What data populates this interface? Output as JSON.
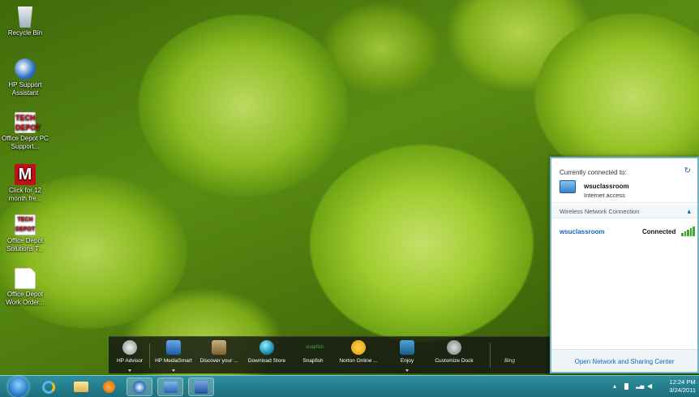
{
  "desktop": {
    "icons": [
      {
        "label": "Recycle Bin",
        "icon": "recycle-bin-icon"
      },
      {
        "label": "HP Support Assistant",
        "icon": "hp-support-icon"
      },
      {
        "label": "Office Depot PC Support...",
        "icon": "office-depot-tech-icon",
        "logo_text": "TECH DEPOT"
      },
      {
        "label": "Click for 12 month fre...",
        "icon": "mcafee-icon",
        "logo_text": "M"
      },
      {
        "label": "Office Depot Solutions T...",
        "icon": "office-depot-solutions-icon",
        "logo_text": "TECH DEPOT"
      },
      {
        "label": "Office Depot Work Order...",
        "icon": "document-icon"
      }
    ]
  },
  "dock": {
    "items": [
      {
        "label": "HP Advisor",
        "icon": "hp-icon"
      },
      {
        "label": "HP MediaSmart",
        "icon": "mediasmart-icon"
      },
      {
        "label": "Discover your ...",
        "icon": "discover-icon"
      },
      {
        "label": "Download Store",
        "icon": "download-store-icon"
      },
      {
        "label": "Snapfish",
        "icon": "snapfish-icon"
      },
      {
        "label": "Norton Online ...",
        "icon": "norton-icon"
      },
      {
        "label": "Enjoy",
        "icon": "tv-icon"
      },
      {
        "label": "Customize Dock",
        "icon": "gear-icon"
      }
    ],
    "bing_label": "Bing"
  },
  "taskbar": {
    "pinned": [
      {
        "icon": "start-orb-icon"
      },
      {
        "icon": "internet-explorer-icon"
      },
      {
        "icon": "folder-icon"
      },
      {
        "icon": "media-player-icon"
      },
      {
        "icon": "hp-icon"
      },
      {
        "icon": "mediasmart-icon"
      },
      {
        "icon": "word-icon"
      }
    ],
    "clock": {
      "time": "12:24 PM",
      "date": "3/24/2011"
    }
  },
  "network_flyout": {
    "currently_connected_label": "Currently connected to:",
    "network_name": "wsuclassroom",
    "access_status": "Internet access",
    "section_title": "Wireless Network Connection",
    "list": [
      {
        "name": "wsuclassroom",
        "status": "Connected"
      }
    ],
    "footer_link": "Open Network and Sharing Center"
  },
  "colors": {
    "accent": "#1565c0",
    "taskbar": "#1c6e7c",
    "signal": "#3aaa2c"
  }
}
